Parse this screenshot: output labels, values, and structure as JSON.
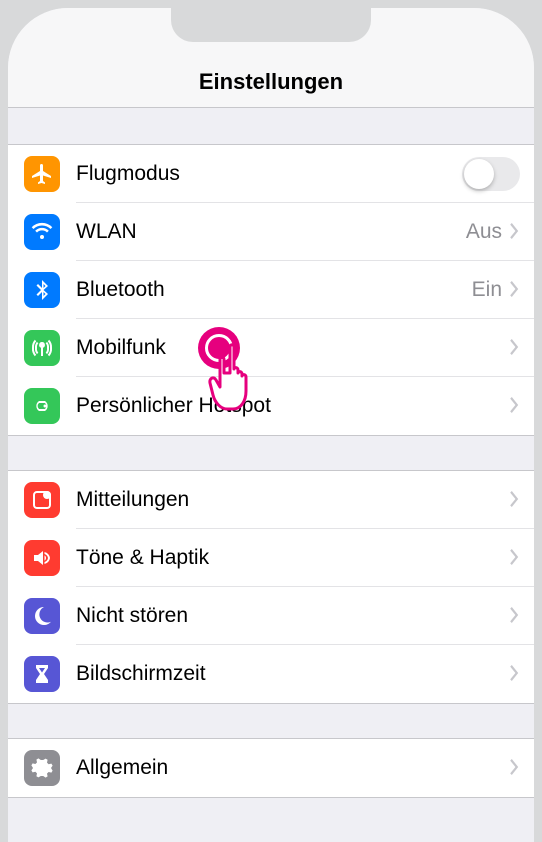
{
  "header": {
    "title": "Einstellungen"
  },
  "groups": [
    {
      "rows": [
        {
          "id": "airplane",
          "icon": "airplane-icon",
          "iconColor": "bg-orange",
          "label": "Flugmodus",
          "control": "toggle",
          "toggleOn": false
        },
        {
          "id": "wifi",
          "icon": "wifi-icon",
          "iconColor": "bg-blue",
          "label": "WLAN",
          "value": "Aus",
          "control": "disclosure"
        },
        {
          "id": "bluetooth",
          "icon": "bluetooth-icon",
          "iconColor": "bg-blue",
          "label": "Bluetooth",
          "value": "Ein",
          "control": "disclosure"
        },
        {
          "id": "cellular",
          "icon": "cellular-icon",
          "iconColor": "bg-green",
          "label": "Mobilfunk",
          "control": "disclosure"
        },
        {
          "id": "hotspot",
          "icon": "hotspot-icon",
          "iconColor": "bg-green",
          "label": "Persönlicher Hotspot",
          "control": "disclosure"
        }
      ]
    },
    {
      "rows": [
        {
          "id": "notifications",
          "icon": "notifications-icon",
          "iconColor": "bg-red",
          "label": "Mitteilungen",
          "control": "disclosure"
        },
        {
          "id": "sounds",
          "icon": "sounds-icon",
          "iconColor": "bg-redpink",
          "label": "Töne & Haptik",
          "control": "disclosure"
        },
        {
          "id": "dnd",
          "icon": "moon-icon",
          "iconColor": "bg-purple",
          "label": "Nicht stören",
          "control": "disclosure"
        },
        {
          "id": "screentime",
          "icon": "hourglass-icon",
          "iconColor": "bg-indigo",
          "label": "Bildschirmzeit",
          "control": "disclosure"
        }
      ]
    },
    {
      "rows": [
        {
          "id": "general",
          "icon": "gear-icon",
          "iconColor": "bg-gray",
          "label": "Allgemein",
          "control": "disclosure"
        }
      ]
    }
  ],
  "pointer": {
    "target": "cellular"
  }
}
